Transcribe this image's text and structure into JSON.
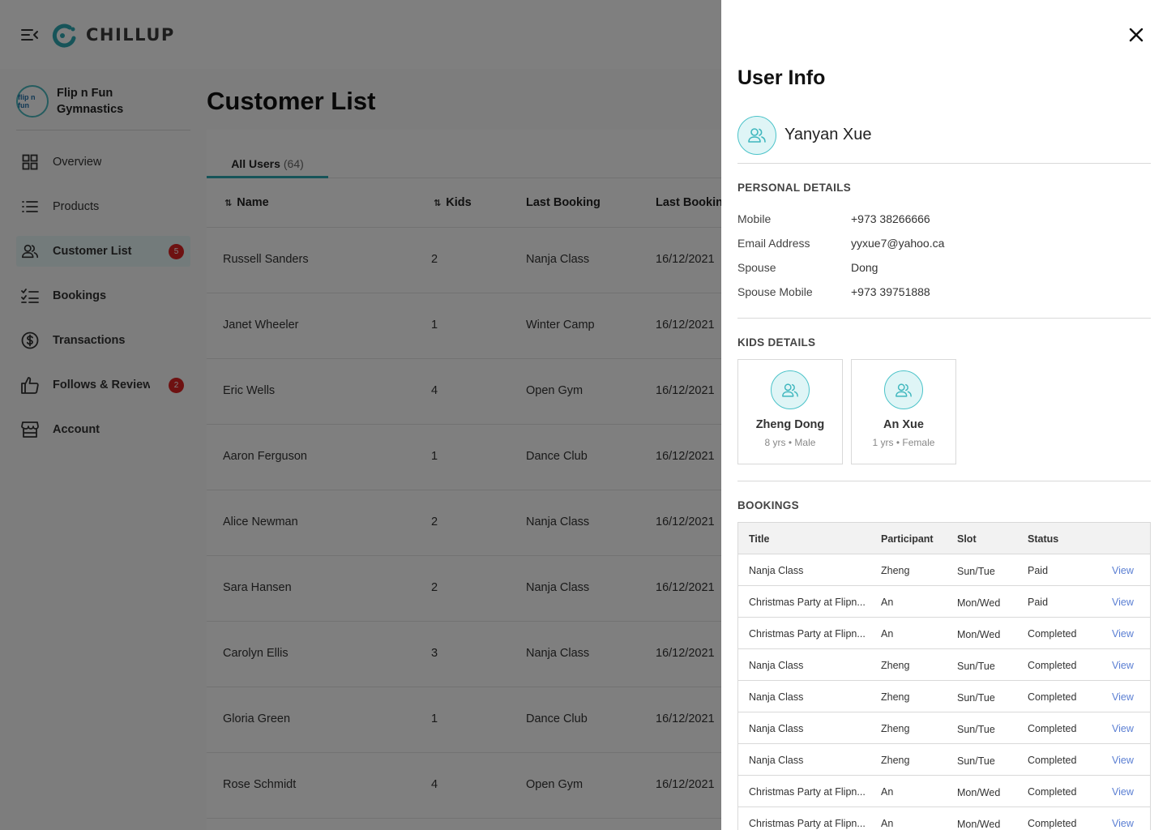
{
  "app": {
    "brand": "CHILLUP",
    "org": {
      "avatar_text": "flip n fun",
      "name": "Flip n Fun Gymnastics"
    },
    "nav": [
      {
        "key": "overview",
        "label": "Overview",
        "icon": "grid-icon",
        "active": false,
        "badge": ""
      },
      {
        "key": "products",
        "label": "Products",
        "icon": "list-icon",
        "active": false,
        "badge": ""
      },
      {
        "key": "customers",
        "label": "Customer List",
        "icon": "users-icon",
        "active": true,
        "badge": "5"
      },
      {
        "key": "bookings",
        "label": "Bookings",
        "icon": "checklist-icon",
        "active": false,
        "badge": ""
      },
      {
        "key": "transactions",
        "label": "Transactions",
        "icon": "dollar-icon",
        "active": false,
        "badge": ""
      },
      {
        "key": "follows",
        "label": "Follows & Reviews",
        "icon": "thumbs-up-icon",
        "active": false,
        "badge": "2"
      },
      {
        "key": "account",
        "label": "Account",
        "icon": "store-icon",
        "active": false,
        "badge": ""
      }
    ]
  },
  "customer_list": {
    "title": "Customer List",
    "tab": {
      "label": "All Users",
      "count": "(64)"
    },
    "columns": [
      "Name",
      "Kids",
      "Last Booking",
      "Last Booking"
    ],
    "rows": [
      {
        "name": "Russell Sanders",
        "kids": "2",
        "last_booking": "Nanja Class",
        "date": "16/12/2021"
      },
      {
        "name": "Janet Wheeler",
        "kids": "1",
        "last_booking": "Winter Camp",
        "date": "16/12/2021"
      },
      {
        "name": "Eric Wells",
        "kids": "4",
        "last_booking": "Open Gym",
        "date": "16/12/2021"
      },
      {
        "name": "Aaron Ferguson",
        "kids": "1",
        "last_booking": "Dance Club",
        "date": "16/12/2021"
      },
      {
        "name": "Alice Newman",
        "kids": "2",
        "last_booking": "Nanja Class",
        "date": "16/12/2021"
      },
      {
        "name": "Sara Hansen",
        "kids": "2",
        "last_booking": "Nanja Class",
        "date": "16/12/2021"
      },
      {
        "name": "Carolyn Ellis",
        "kids": "3",
        "last_booking": "Nanja Class",
        "date": "16/12/2021"
      },
      {
        "name": "Gloria Green",
        "kids": "1",
        "last_booking": "Dance Club",
        "date": "16/12/2021"
      },
      {
        "name": "Rose Schmidt",
        "kids": "4",
        "last_booking": "Open Gym",
        "date": "16/12/2021"
      }
    ]
  },
  "user_info": {
    "title": "User Info",
    "name": "Yanyan Xue",
    "personal_title": "PERSONAL DETAILS",
    "personal": [
      {
        "label": "Mobile",
        "value": "+973 38266666"
      },
      {
        "label": "Email Address",
        "value": "yyxue7@yahoo.ca"
      },
      {
        "label": "Spouse",
        "value": "Dong"
      },
      {
        "label": "Spouse Mobile",
        "value": "+973 39751888"
      }
    ],
    "kids_title": "KIDS DETAILS",
    "kids": [
      {
        "name": "Zheng Dong",
        "meta": "8 yrs • Male"
      },
      {
        "name": "An Xue",
        "meta": "1 yrs • Female"
      }
    ],
    "bookings_title": "BOOKINGS",
    "booking_columns": {
      "title": "Title",
      "participant": "Participant",
      "slot": "Slot",
      "status": "Status"
    },
    "bookings": [
      {
        "title": "Nanja Class",
        "participant": "Zheng",
        "slot": "Sun/Tue",
        "status": "Paid",
        "action": "View"
      },
      {
        "title": "Christmas Party at Flipn...",
        "participant": "An",
        "slot": "Mon/Wed",
        "status": "Paid",
        "action": "View"
      },
      {
        "title": "Christmas Party at Flipn...",
        "participant": "An",
        "slot": "Mon/Wed",
        "status": "Completed",
        "action": "View"
      },
      {
        "title": "Nanja Class",
        "participant": "Zheng",
        "slot": "Sun/Tue",
        "status": "Completed",
        "action": "View"
      },
      {
        "title": "Nanja Class",
        "participant": "Zheng",
        "slot": "Sun/Tue",
        "status": "Completed",
        "action": "View"
      },
      {
        "title": "Nanja Class",
        "participant": "Zheng",
        "slot": "Sun/Tue",
        "status": "Completed",
        "action": "View"
      },
      {
        "title": "Nanja Class",
        "participant": "Zheng",
        "slot": "Sun/Tue",
        "status": "Completed",
        "action": "View"
      },
      {
        "title": "Christmas Party at Flipn...",
        "participant": "An",
        "slot": "Mon/Wed",
        "status": "Completed",
        "action": "View"
      },
      {
        "title": "Christmas Party at Flipn...",
        "participant": "An",
        "slot": "Mon/Wed",
        "status": "Completed",
        "action": "View"
      }
    ]
  },
  "colors": {
    "accent": "#2ea9b3",
    "badge": "#dd2222",
    "link": "#5b7fd3",
    "overlay": "rgba(0,0,0,0.5)"
  }
}
